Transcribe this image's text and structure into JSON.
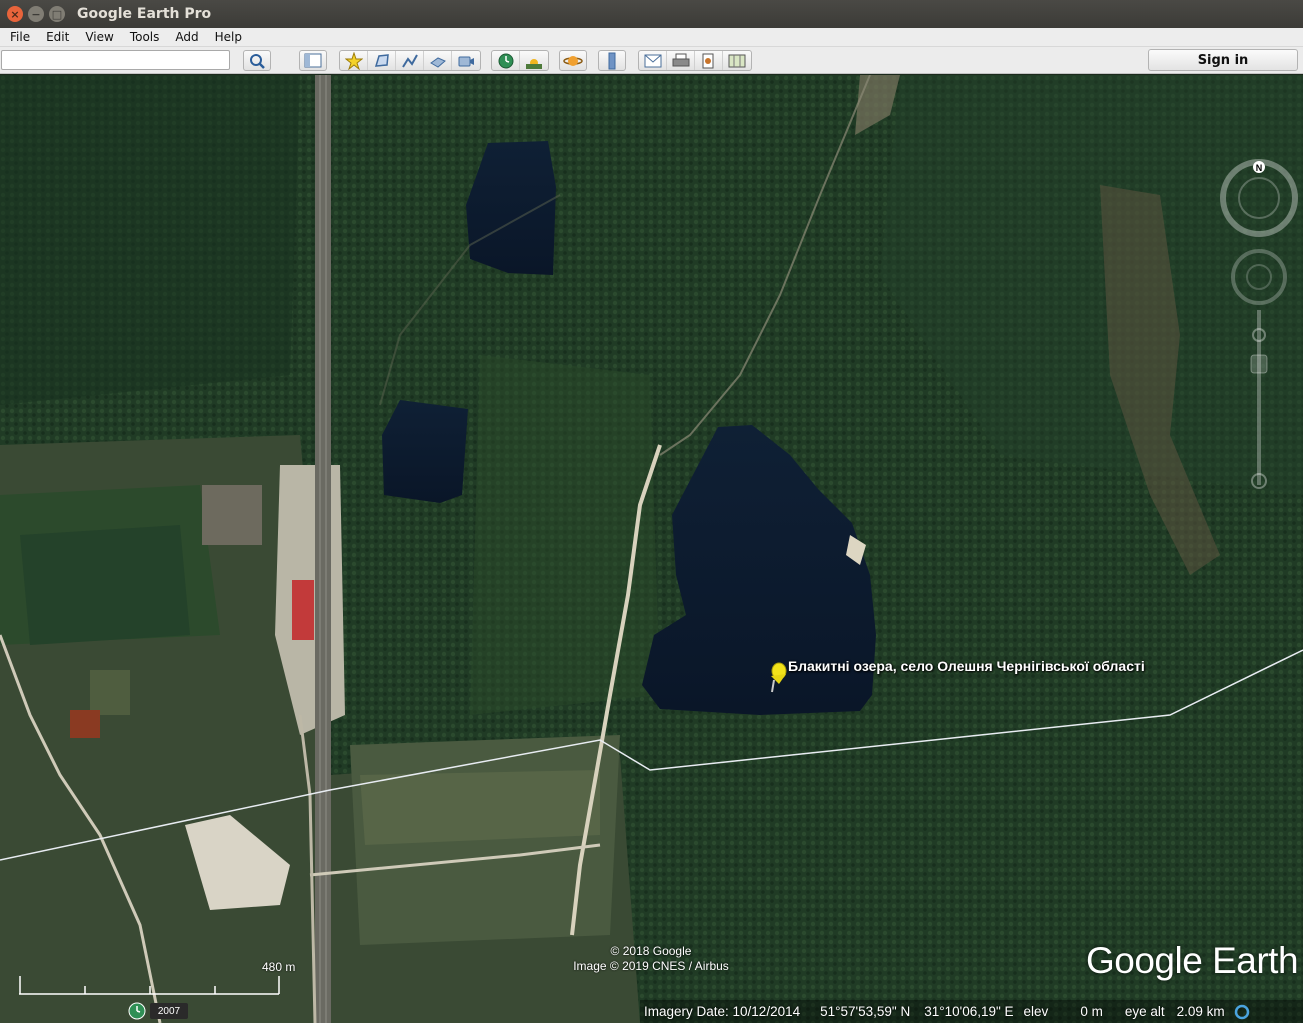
{
  "window": {
    "title": "Google Earth Pro"
  },
  "menu": {
    "items": [
      "File",
      "Edit",
      "View",
      "Tools",
      "Add",
      "Help"
    ]
  },
  "toolbar": {
    "search_value": "",
    "search_placeholder": "",
    "sign_in_label": "Sign in",
    "icons": [
      "search-icon",
      "sidebar-toggle-icon",
      "placemark-add-icon",
      "polygon-add-icon",
      "path-add-icon",
      "overlay-add-icon",
      "tour-record-icon",
      "historical-imagery-icon",
      "sunlight-icon",
      "planet-switch-icon",
      "ruler-icon",
      "email-icon",
      "print-icon",
      "save-image-icon",
      "view-in-maps-icon"
    ]
  },
  "map": {
    "placemark_label": "Блакитні озера, село Олешня Чернігівської області",
    "attribution": {
      "line1": "© 2018 Google",
      "line2": "Image © 2019 CNES / Airbus"
    },
    "logo": "Google Earth",
    "scale_label": "480 m",
    "historical_year": "2007",
    "compass_north": "N"
  },
  "status": {
    "imagery_date": "Imagery Date: 10/12/2014",
    "latitude": "51°57'53,59\" N",
    "longitude": "31°10'06,19\" E",
    "elev_label": "elev",
    "elev_value": "0 m",
    "eye_alt_label": "eye alt",
    "eye_alt_value": "2.09 km"
  },
  "colors": {
    "forest": "#1f3a24",
    "lake": "#0e1e33",
    "pin": "#f2e21a"
  }
}
